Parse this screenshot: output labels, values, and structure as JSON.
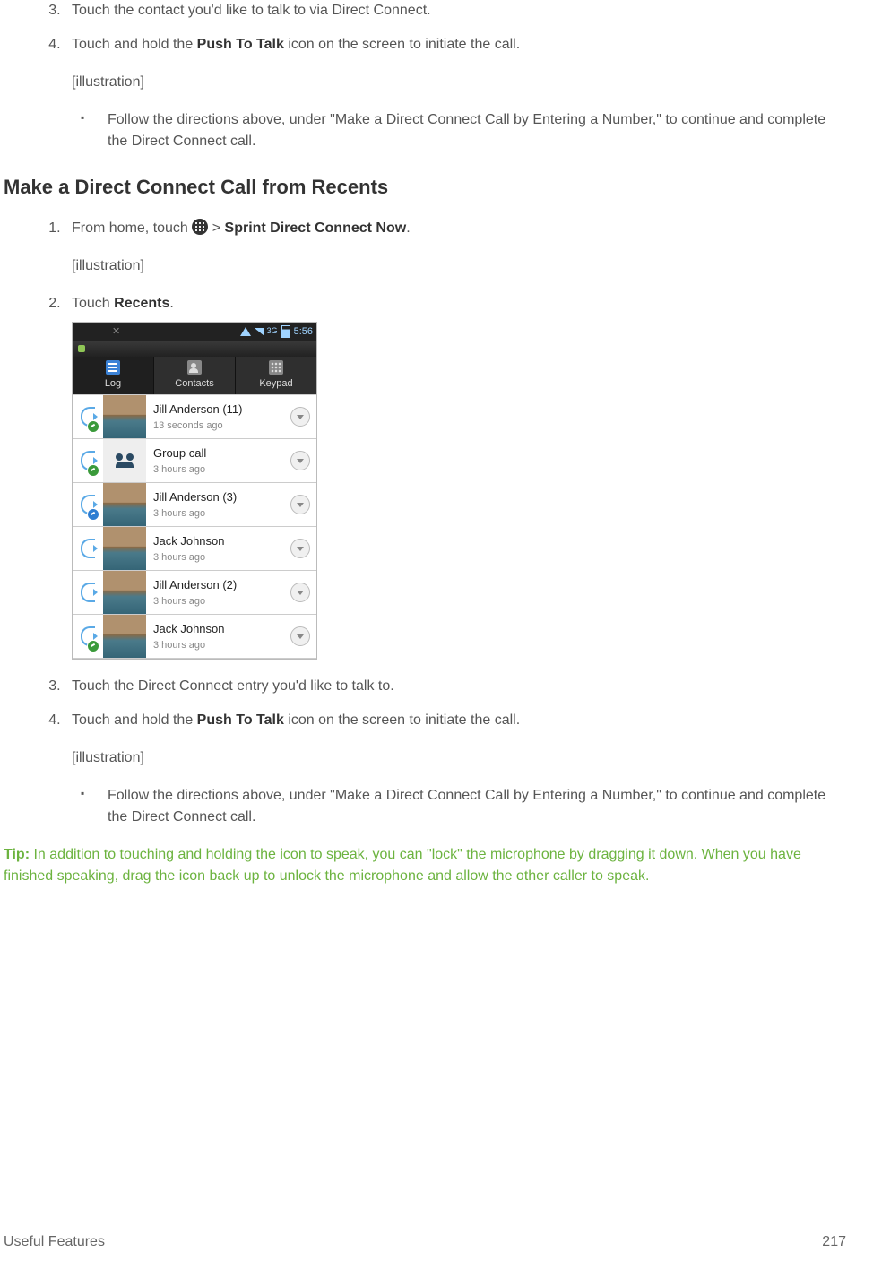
{
  "steps_top": {
    "s3": "Touch the contact you'd like to talk to via Direct Connect.",
    "s4_pre": "Touch and hold the ",
    "s4_bold": "Push To Talk",
    "s4_post": " icon on the screen to initiate the call.",
    "illus": "[illustration]",
    "bullet": "Follow the directions above, under \"Make a Direct Connect Call by Entering a Number,\" to continue and complete the Direct Connect call."
  },
  "heading": "Make a Direct Connect Call from Recents",
  "steps_recents": {
    "s1_pre": "From home, touch ",
    "s1_mid": " > ",
    "s1_bold": "Sprint Direct Connect Now",
    "s1_post": ".",
    "illus1": "[illustration]",
    "s2_pre": "Touch ",
    "s2_bold": "Recents",
    "s2_post": ".",
    "s3": "Touch the Direct Connect entry you'd like to talk to.",
    "s4_pre": "Touch and hold the ",
    "s4_bold": "Push To Talk",
    "s4_post": " icon on the screen to initiate the call.",
    "illus2": "[illustration]",
    "bullet": "Follow the directions above, under \"Make a Direct Connect Call by Entering a Number,\" to continue and complete the Direct Connect call."
  },
  "tip": {
    "label": "Tip:",
    "text": " In addition to touching and holding the icon to speak, you can \"lock\" the microphone by dragging it down. When you have finished speaking, drag the icon back up to unlock the microphone and allow the other caller to speak."
  },
  "footer": {
    "section": "Useful Features",
    "page": "217"
  },
  "screenshot": {
    "time": "5:56",
    "network": "3G",
    "tabs": {
      "log": "Log",
      "contacts": "Contacts",
      "keypad": "Keypad"
    },
    "rows": [
      {
        "name": "Jill Anderson (11)",
        "time": "13 seconds ago",
        "icon": "ptt-badge-green",
        "thumb": true
      },
      {
        "name": "Group call",
        "time": "3 hours ago",
        "icon": "ptt-badge-green",
        "group": true
      },
      {
        "name": "Jill Anderson (3)",
        "time": "3 hours ago",
        "icon": "ptt-badge-blue",
        "thumb": true
      },
      {
        "name": "Jack Johnson",
        "time": "3 hours ago",
        "icon": "ptt",
        "thumb": true
      },
      {
        "name": "Jill Anderson (2)",
        "time": "3 hours ago",
        "icon": "ptt",
        "thumb": true
      },
      {
        "name": "Jack Johnson",
        "time": "3 hours ago",
        "icon": "ptt-badge-green",
        "thumb": true
      }
    ]
  }
}
